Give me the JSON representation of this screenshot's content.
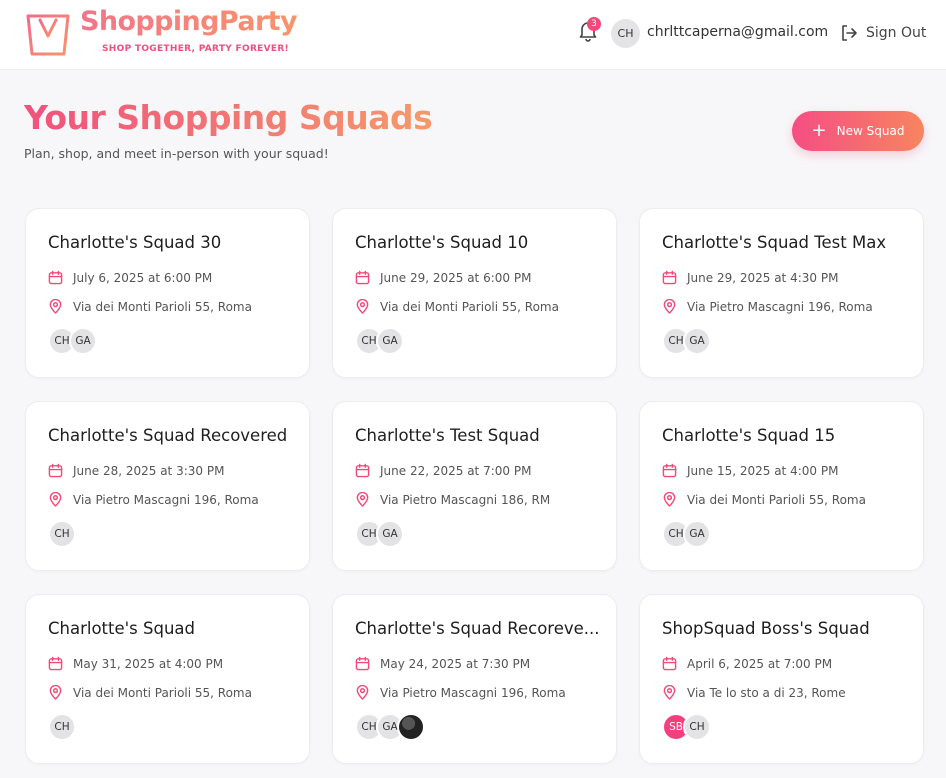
{
  "header": {
    "brand": "ShoppingParty",
    "tagline": "SHOP TOGETHER, PARTY FOREVER!",
    "notification_count": "3",
    "user_initials": "CH",
    "user_email": "chrlttcaperna@gmail.com",
    "sign_out_label": "Sign Out"
  },
  "page": {
    "title": "Your Shopping Squads",
    "subtitle": "Plan, shop, and meet in-person with your squad!",
    "new_squad_label": "New Squad"
  },
  "colors": {
    "accent_pink": "#f24a78",
    "accent_orange": "#f7855f"
  },
  "squads": [
    {
      "name": "Charlotte's Squad 30",
      "date": "July 6, 2025 at 6:00 PM",
      "location": "Via dei Monti Parioli 55, Roma",
      "members": [
        "CH",
        "GA"
      ]
    },
    {
      "name": "Charlotte's Squad 10",
      "date": "June 29, 2025 at 6:00 PM",
      "location": "Via dei Monti Parioli 55, Roma",
      "members": [
        "CH",
        "GA"
      ]
    },
    {
      "name": "Charlotte's Squad Test Max",
      "date": "June 29, 2025 at 4:30 PM",
      "location": "Via Pietro Mascagni 196, Roma",
      "members": [
        "CH",
        "GA"
      ]
    },
    {
      "name": "Charlotte's Squad Recovered",
      "date": "June 28, 2025 at 3:30 PM",
      "location": "Via Pietro Mascagni 196, Roma",
      "members": [
        "CH"
      ]
    },
    {
      "name": "Charlotte's Test Squad",
      "date": "June 22, 2025 at 7:00 PM",
      "location": "Via Pietro Mascagni 186, RM",
      "members": [
        "CH",
        "GA"
      ]
    },
    {
      "name": "Charlotte's Squad 15",
      "date": "June 15, 2025 at 4:00 PM",
      "location": "Via dei Monti Parioli 55, Roma",
      "members": [
        "CH",
        "GA"
      ]
    },
    {
      "name": "Charlotte's Squad",
      "date": "May 31, 2025 at 4:00 PM",
      "location": "Via dei Monti Parioli 55, Roma",
      "members": [
        "CH"
      ]
    },
    {
      "name": "Charlotte's Squad Recoreve...",
      "date": "May 24, 2025 at 7:30 PM",
      "location": "Via Pietro Mascagni 196, Roma",
      "members": [
        "CH",
        "GA",
        ""
      ]
    },
    {
      "name": "ShopSquad Boss's Squad",
      "date": "April 6, 2025 at 7:00 PM",
      "location": "Via Te lo sto a di 23, Rome",
      "members": [
        "SB",
        "CH"
      ]
    }
  ]
}
